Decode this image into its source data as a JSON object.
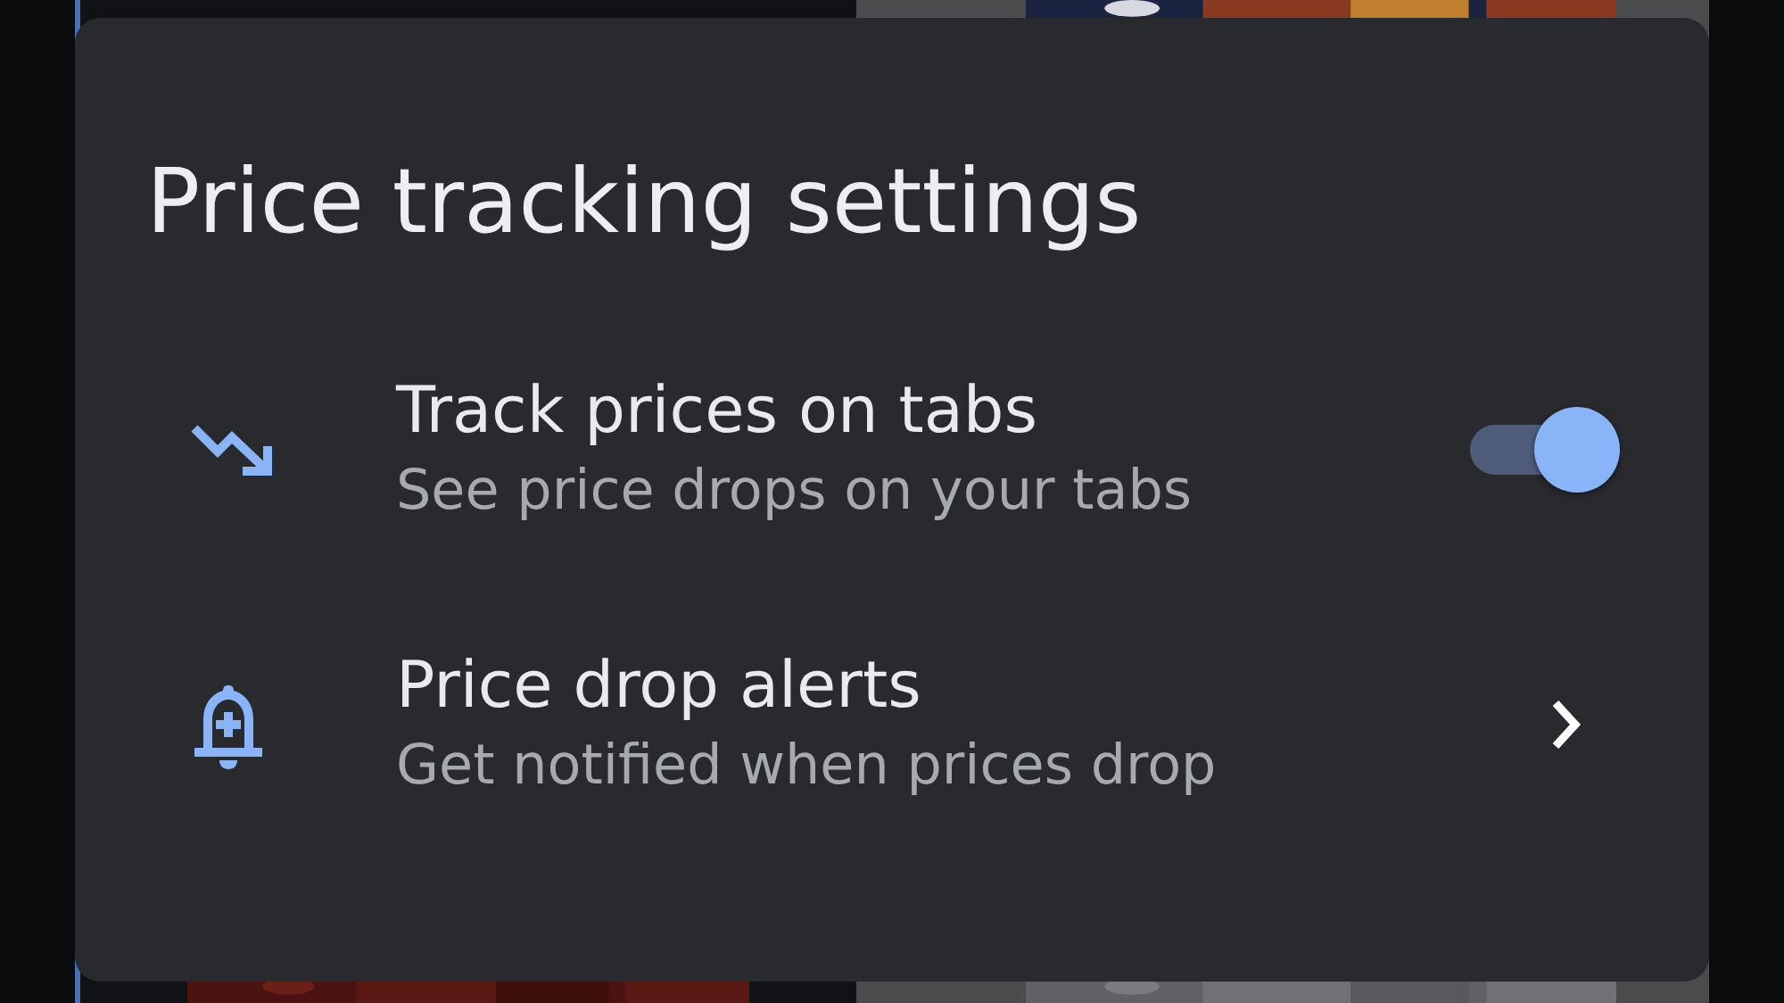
{
  "dialog": {
    "title": "Price tracking settings",
    "items": [
      {
        "kind": "toggle",
        "title": "Track prices on tabs",
        "subtitle": "See price drops on your tabs",
        "on": true
      },
      {
        "kind": "link",
        "title": "Price drop alerts",
        "subtitle": "Get notified when prices drop"
      }
    ]
  }
}
